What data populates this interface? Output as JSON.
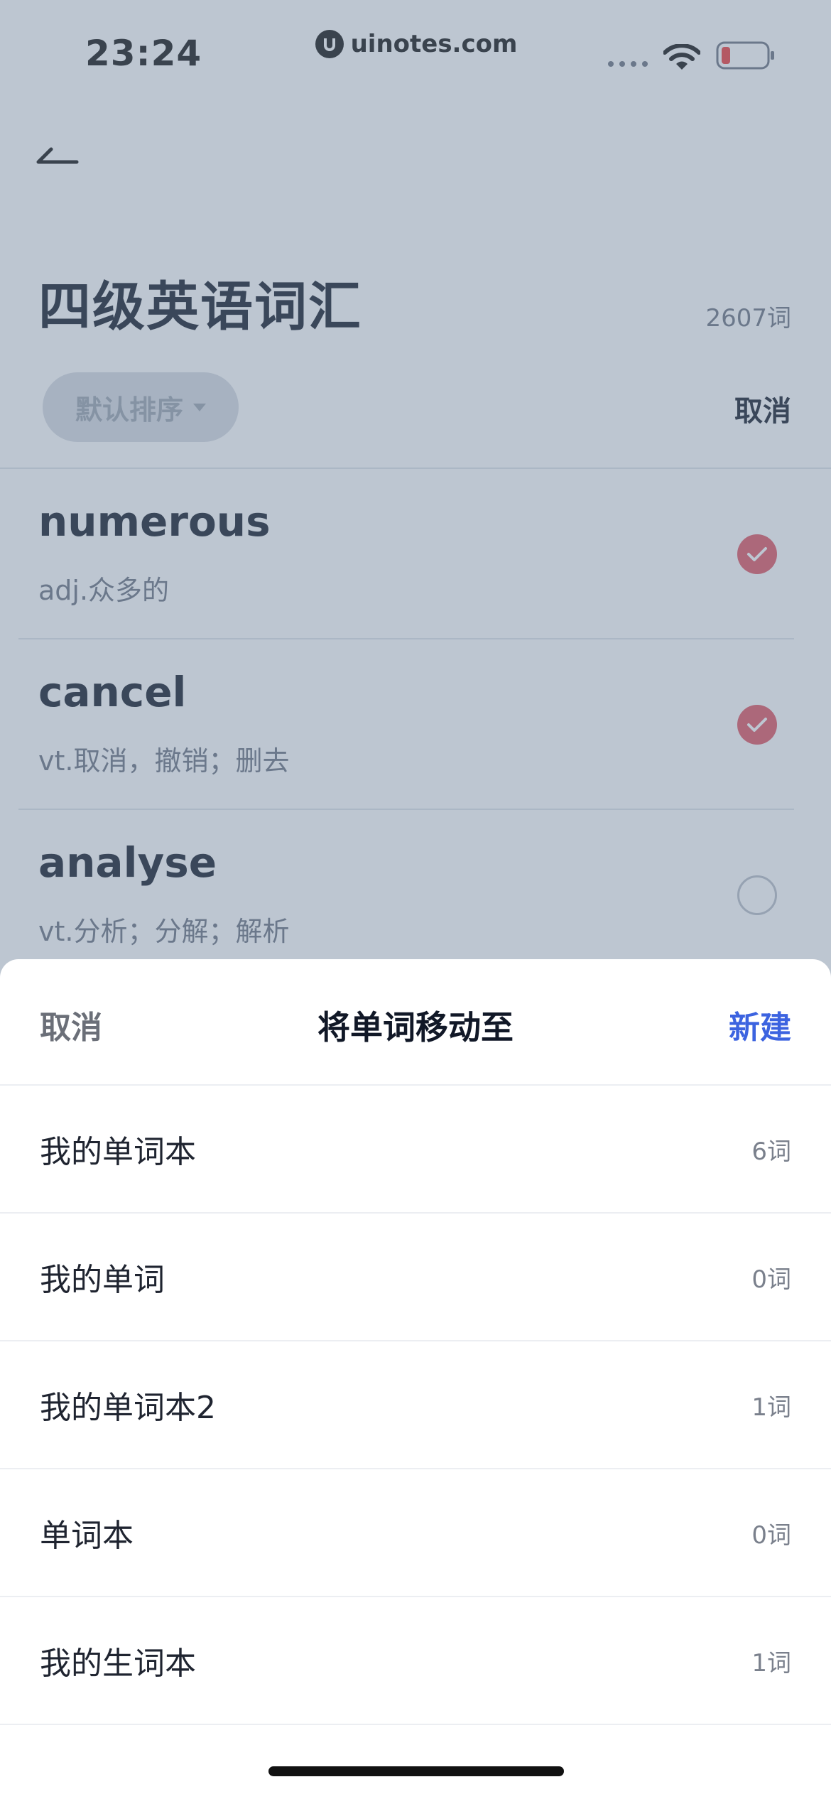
{
  "status": {
    "time": "23:24",
    "url": "uinotes.com"
  },
  "header": {
    "title": "四级英语词汇",
    "count": "2607词",
    "sort_label": "默认排序",
    "cancel_label": "取消"
  },
  "words": [
    {
      "word": "numerous",
      "definition": "adj.众多的",
      "selected": true
    },
    {
      "word": "cancel",
      "definition": "vt.取消，撤销；删去",
      "selected": true
    },
    {
      "word": "analyse",
      "definition": "vt.分析；分解；解析",
      "selected": false
    }
  ],
  "sheet": {
    "cancel_label": "取消",
    "title": "将单词移动至",
    "new_label": "新建",
    "books": [
      {
        "name": "我的单词本",
        "count": "6词"
      },
      {
        "name": "我的单词",
        "count": "0词"
      },
      {
        "name": "我的单词本2",
        "count": "1词"
      },
      {
        "name": "单词本",
        "count": "0词"
      },
      {
        "name": "我的生词本",
        "count": "1词"
      }
    ]
  },
  "colors": {
    "accent_blue": "#3c63e0",
    "check_red": "#e05561",
    "overlay": "#6c8098"
  },
  "icons": [
    "back-arrow-icon",
    "chevron-down-icon",
    "check-icon",
    "wifi-icon",
    "battery-icon",
    "signal-icon",
    "uinotes-logo-icon"
  ]
}
